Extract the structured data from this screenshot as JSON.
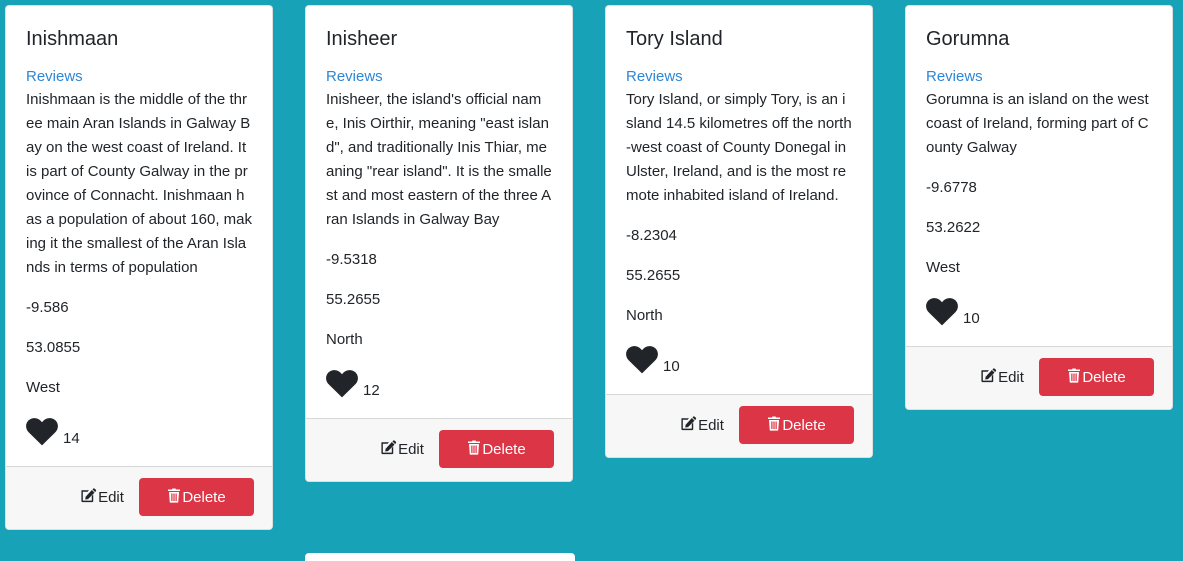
{
  "cards": [
    {
      "title": "Inishmaan",
      "reviews_link": "Reviews",
      "description": "Inishmaan is the middle of the three main Aran Islands in Galway Bay on the west coast of Ireland. It is part of County Galway in the province of Connacht. Inishmaan has a population of about 160, making it the smallest of the Aran Islands in terms of population",
      "longitude": "-9.586",
      "latitude": "53.0855",
      "region": "West",
      "likes": "14",
      "edit_label": "Edit",
      "delete_label": "Delete"
    },
    {
      "title": "Inisheer",
      "reviews_link": "Reviews",
      "description": "Inisheer, the island's official name, Inis Oirthir, meaning \"east island\", and traditionally Inis Thiar, meaning \"rear island\". It is the smallest and most eastern of the three Aran Islands in Galway Bay",
      "longitude": "-9.5318",
      "latitude": "55.2655",
      "region": "North",
      "likes": "12",
      "edit_label": "Edit",
      "delete_label": "Delete"
    },
    {
      "title": "Tory Island",
      "reviews_link": "Reviews",
      "description": "Tory Island, or simply Tory, is an island 14.5 kilometres off the north-west coast of County Donegal in Ulster, Ireland, and is the most remote inhabited island of Ireland.",
      "longitude": "-8.2304",
      "latitude": "55.2655",
      "region": "North",
      "likes": "10",
      "edit_label": "Edit",
      "delete_label": "Delete"
    },
    {
      "title": "Gorumna",
      "reviews_link": "Reviews",
      "description": "Gorumna is an island on the west coast of Ireland, forming part of County Galway",
      "longitude": "-9.6778",
      "latitude": "53.2622",
      "region": "West",
      "likes": "10",
      "edit_label": "Edit",
      "delete_label": "Delete"
    }
  ],
  "icons": {
    "like": "heart-icon",
    "edit": "edit-icon",
    "delete": "trash-icon"
  },
  "colors": {
    "page_background": "#17a2b8",
    "link": "#2f86d6",
    "delete_button": "#dc3545"
  }
}
